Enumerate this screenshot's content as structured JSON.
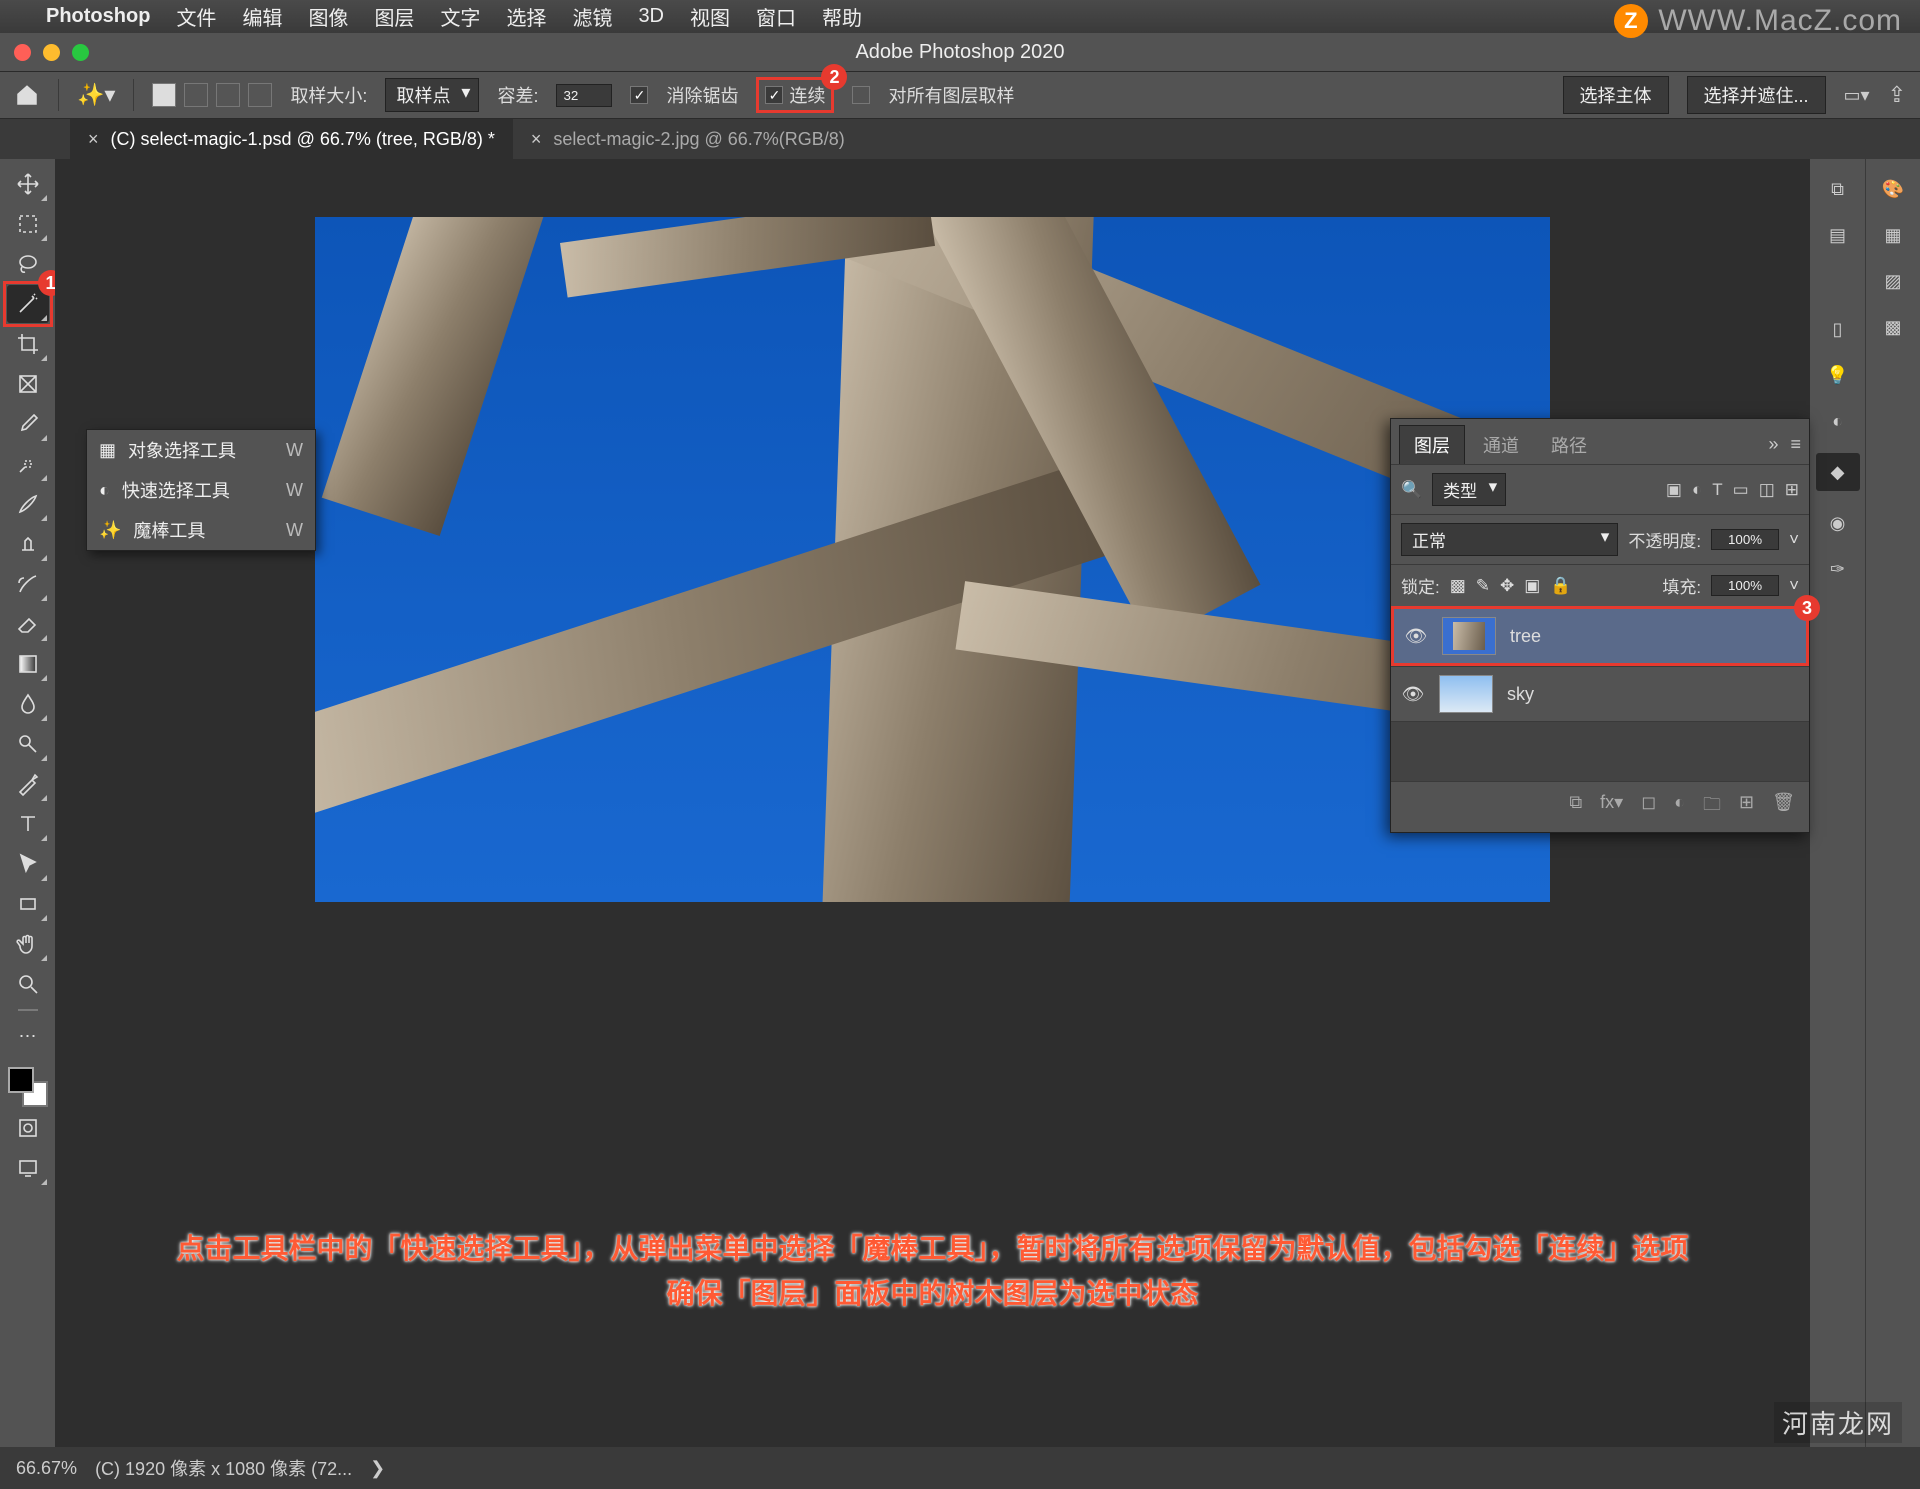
{
  "mac_menu": {
    "app": "Photoshop",
    "items": [
      "文件",
      "编辑",
      "图像",
      "图层",
      "文字",
      "选择",
      "滤镜",
      "3D",
      "视图",
      "窗口",
      "帮助"
    ]
  },
  "window_title": "Adobe Photoshop 2020",
  "options": {
    "sample_label": "取样大小:",
    "sample_value": "取样点",
    "tolerance_label": "容差:",
    "tolerance_value": "32",
    "anti_alias": "消除锯齿",
    "contiguous": "连续",
    "all_layers": "对所有图层取样",
    "select_subject": "选择主体",
    "select_mask": "选择并遮住..."
  },
  "tabs": [
    {
      "label": "(C) select-magic-1.psd @ 66.7% (tree, RGB/8) *",
      "active": true
    },
    {
      "label": "select-magic-2.jpg @ 66.7%(RGB/8)",
      "active": false
    }
  ],
  "flyout": {
    "items": [
      {
        "label": "对象选择工具",
        "key": "W"
      },
      {
        "label": "快速选择工具",
        "key": "W"
      },
      {
        "label": "魔棒工具",
        "key": "W"
      }
    ]
  },
  "layers_panel": {
    "tabs": [
      "图层",
      "通道",
      "路径"
    ],
    "filter_label": "类型",
    "blend": "正常",
    "opacity_label": "不透明度:",
    "opacity_value": "100%",
    "lock_label": "锁定:",
    "fill_label": "填充:",
    "fill_value": "100%",
    "layers": [
      {
        "name": "tree",
        "selected": true
      },
      {
        "name": "sky",
        "selected": false
      }
    ]
  },
  "caption_line1": "点击工具栏中的「快速选择工具」，从弹出菜单中选择「魔棒工具」，暂时将所有选项保留为默认值，包括勾选「连续」选项",
  "caption_line2": "确保「图层」面板中的树木图层为选中状态",
  "status": {
    "zoom": "66.67%",
    "doc": "(C) 1920 像素 x 1080 像素 (72..."
  },
  "badges": {
    "tool": "1",
    "contig": "2",
    "layer": "3"
  },
  "watermark_tr": "WWW.MacZ.com",
  "watermark_br": "河南龙网"
}
